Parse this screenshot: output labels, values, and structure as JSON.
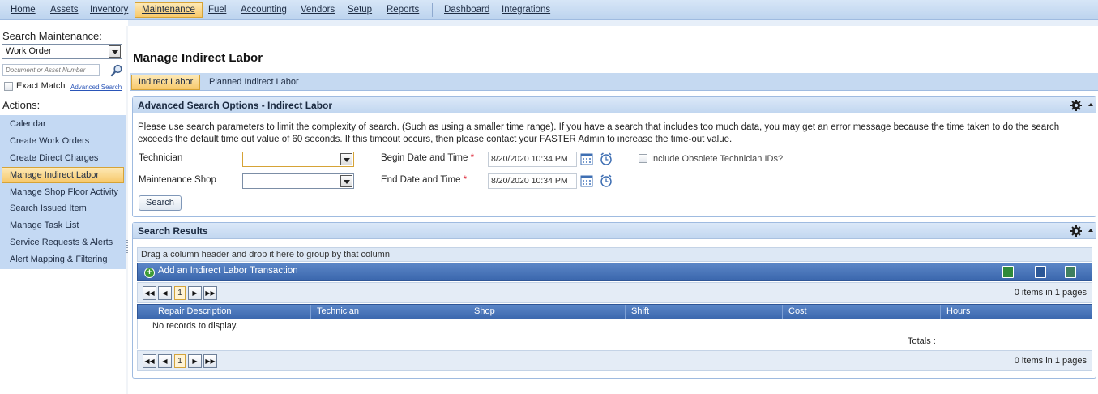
{
  "menu": {
    "items": [
      "Home",
      "Assets",
      "Inventory",
      "Maintenance",
      "Fuel",
      "Accounting",
      "Vendors",
      "Setup",
      "Reports",
      "Dashboard",
      "Integrations"
    ],
    "active": "Maintenance"
  },
  "sidebar": {
    "search_title": "Search Maintenance:",
    "search_type_value": "Work Order",
    "doc_placeholder": "Document or Asset Number",
    "exact_match_label": "Exact Match",
    "advanced_search_link": "Advanced Search",
    "actions_title": "Actions:",
    "actions": [
      "Calendar",
      "Create Work Orders",
      "Create Direct Charges",
      "Manage Indirect Labor",
      "Manage Shop Floor Activity",
      "Search Issued Item",
      "Manage Task List",
      "Service Requests & Alerts",
      "Alert Mapping & Filtering"
    ],
    "active_action": "Manage Indirect Labor"
  },
  "page": {
    "title": "Manage Indirect Labor",
    "tabs": [
      "Indirect Labor",
      "Planned Indirect Labor"
    ],
    "active_tab": "Indirect Labor"
  },
  "advanced": {
    "title": "Advanced Search Options - Indirect Labor",
    "description": "Please use search parameters to limit the complexity of search. (Such as using a smaller time range). If you have a search that includes too much data, you may get an error message because the time taken to do the search exceeds the default time out value of 60 seconds. If this timeout occurs, then please contact your FASTER Admin to increase the time-out value.",
    "technician_label": "Technician",
    "shop_label": "Maintenance Shop",
    "technician_value": "",
    "shop_value": "",
    "begin_label": "Begin Date and Time",
    "end_label": "End Date and Time",
    "required_mark": "*",
    "begin_value": "8/20/2020 10:34 PM",
    "end_value": "8/20/2020 10:34 PM",
    "obsolete_label": "Include Obsolete Technician IDs?",
    "search_button": "Search"
  },
  "results": {
    "title": "Search Results",
    "group_hint": "Drag a column header and drop it here to group by that column",
    "add_label": "Add an Indirect Labor Transaction",
    "page_number": "1",
    "page_info": "0 items in 1 pages",
    "columns": [
      "Repair Description",
      "Technician",
      "Shop",
      "Shift",
      "Cost",
      "Hours"
    ],
    "no_records": "No records to display.",
    "totals_label": "Totals :"
  },
  "colors": {
    "accent": "#3c68ae",
    "active_bg": "#f7c86a",
    "sidebar_bg": "#c4d9f3"
  }
}
